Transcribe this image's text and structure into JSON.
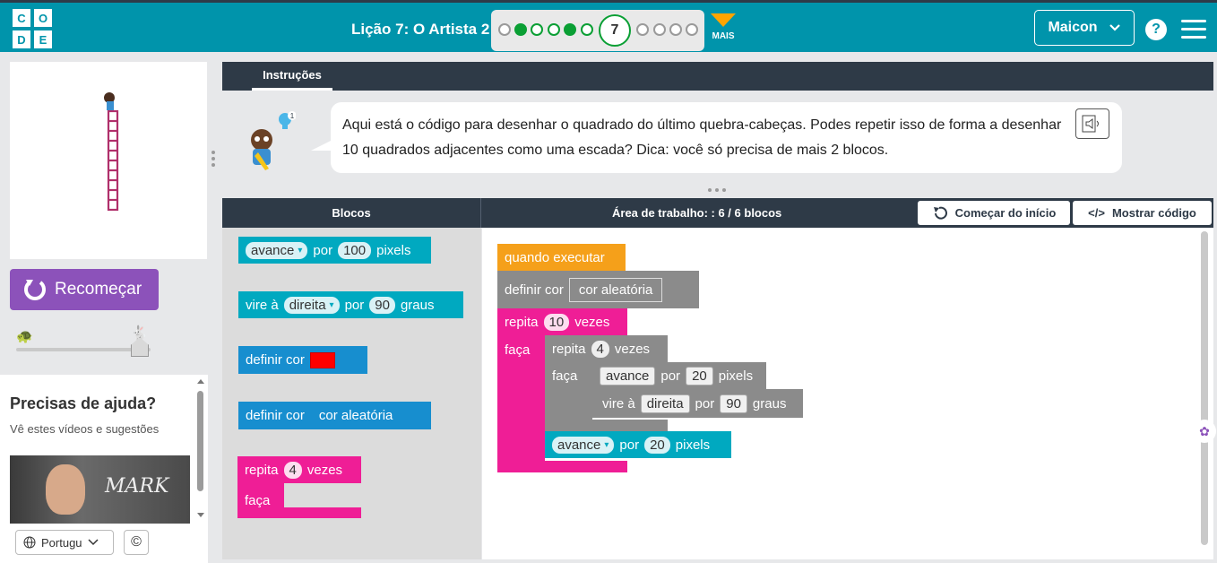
{
  "header": {
    "logo_letters": [
      "C",
      "O",
      "D",
      "E"
    ],
    "lesson_title": "Lição 7: O Artista 2",
    "current_level": "7",
    "mais_label": "MAIS",
    "user_name": "Maicon",
    "help_symbol": "?"
  },
  "instructions": {
    "tab_label": "Instruções",
    "text": "Aqui está o código para desenhar o quadrado do último quebra-cabeças. Podes repetir isso de forma a desenhar 10 quadrados adjacentes como uma escada? Dica: você só precisa de mais 2 blocos.",
    "hint_badge": "1"
  },
  "left": {
    "reset_label": "Recomeçar",
    "help_title": "Precisas de ajuda?",
    "help_subtitle": "Vê estes vídeos e sugestões",
    "video_caption": "MARK",
    "language": "Portugu"
  },
  "workspace_header": {
    "blocks_title": "Blocos",
    "workspace_title": "Área de trabalho: : 6 / 6 blocos",
    "start_over_label": "Começar do início",
    "show_code_label": "Mostrar código"
  },
  "toolbox": {
    "b1": {
      "a": "avance",
      "b": "por",
      "c": "100",
      "d": "pixels"
    },
    "b2": {
      "a": "vire à",
      "b": "direita",
      "c": "por",
      "d": "90",
      "e": "graus"
    },
    "b3": {
      "a": "definir cor"
    },
    "b4": {
      "a": "definir cor",
      "b": "cor aleatória"
    },
    "b5": {
      "a": "repita",
      "b": "4",
      "c": "vezes",
      "d": "faça"
    }
  },
  "program": {
    "when_run": "quando executar",
    "set_color": "definir cor",
    "random_color": "cor aleatória",
    "outer_repeat": "repita",
    "outer_count": "10",
    "times": "vezes",
    "do": "faça",
    "inner_repeat": "repita",
    "inner_count": "4",
    "move": "avance",
    "by": "por",
    "inner_move_value": "20",
    "pixels": "pixels",
    "turn": "vire à",
    "direction": "direita",
    "turn_value": "90",
    "degrees": "graus",
    "outer_move_value": "20"
  },
  "colors": {
    "header": "#0094ab",
    "dark_bar": "#2e3a47",
    "reset_button": "#8c52ba",
    "teal_block": "#00a9c0",
    "blue_block": "#178ecf",
    "pink_block": "#ef1e96",
    "orange_block": "#f5a01a",
    "progress_green": "#0a9f34"
  }
}
